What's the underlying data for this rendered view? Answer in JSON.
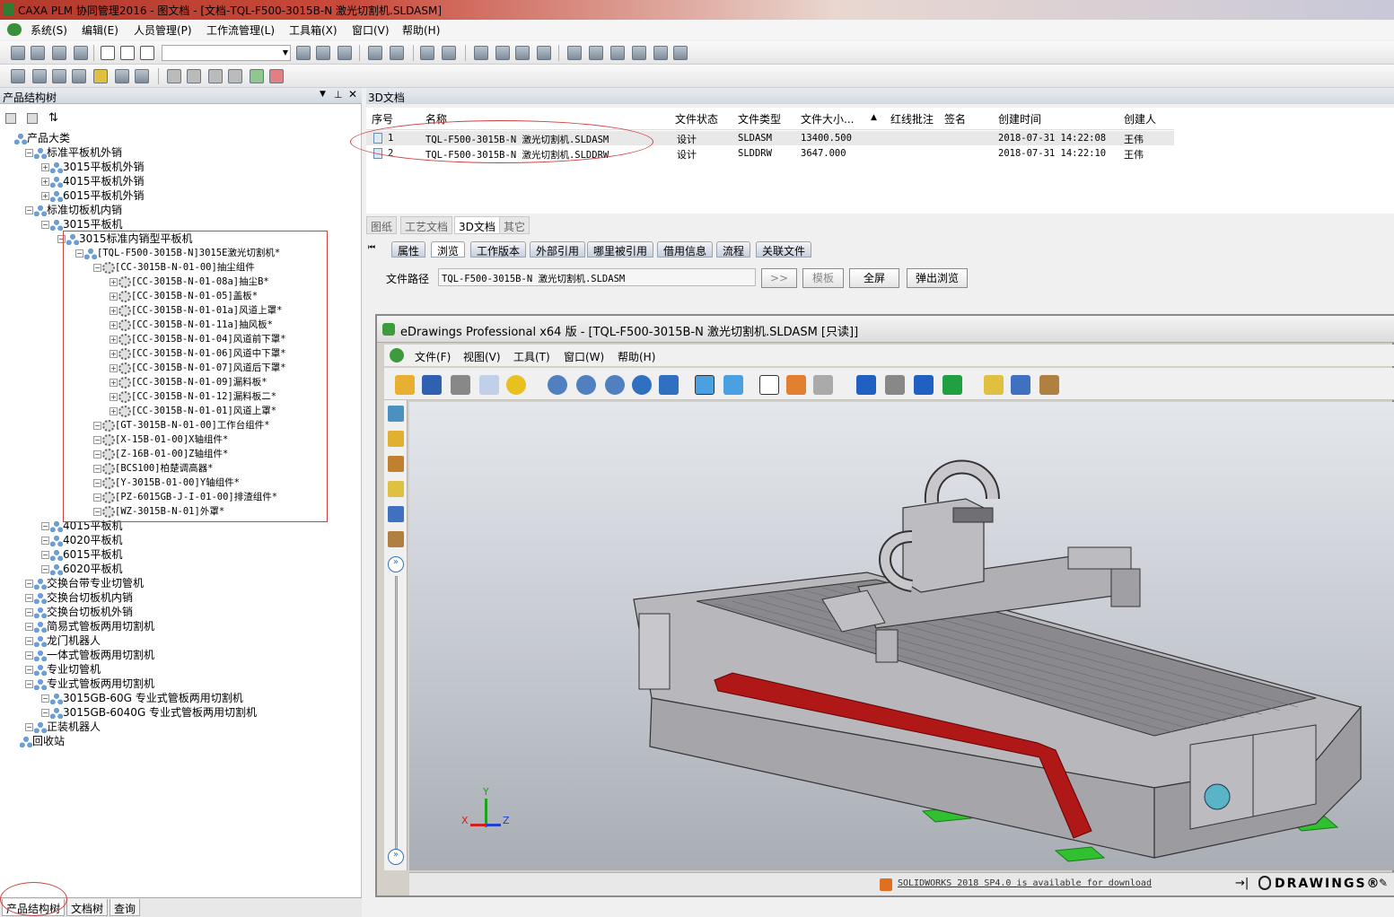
{
  "window": {
    "title": "CAXA PLM 协同管理2016 - 图文档 - [文档-TQL-F500-3015B-N 激光切割机.SLDASM]"
  },
  "menubar": [
    "系统(S)",
    "编辑(E)",
    "人员管理(P)",
    "工作流管理(L)",
    "工具箱(X)",
    "窗口(V)",
    "帮助(H)"
  ],
  "left_panel": {
    "title": "产品结构树",
    "root": "产品大类",
    "tree": [
      {
        "label": "标准平板机外销",
        "level": 1
      },
      {
        "label": "3015平板机外销",
        "level": 2
      },
      {
        "label": "4015平板机外销",
        "level": 2
      },
      {
        "label": "6015平板机外销",
        "level": 2
      },
      {
        "label": "标准切板机内销",
        "level": 1
      },
      {
        "label": "3015平板机",
        "level": 2
      },
      {
        "label": "3015标准内销型平板机",
        "level": 3
      },
      {
        "label": "[TQL-F500-3015B-N]3015E激光切割机*",
        "level": 4,
        "mono": true
      },
      {
        "label": "[CC-3015B-N-01-00]抽尘组件",
        "level": 5,
        "mono": true
      },
      {
        "label": "[CC-3015B-N-01-08a]抽尘B*",
        "level": 6,
        "mono": true
      },
      {
        "label": "[CC-3015B-N-01-05]盖板*",
        "level": 6,
        "mono": true
      },
      {
        "label": "[CC-3015B-N-01-01a]风道上罩*",
        "level": 6,
        "mono": true
      },
      {
        "label": "[CC-3015B-N-01-11a]抽风板*",
        "level": 6,
        "mono": true
      },
      {
        "label": "[CC-3015B-N-01-04]风道前下罩*",
        "level": 6,
        "mono": true
      },
      {
        "label": "[CC-3015B-N-01-06]风道中下罩*",
        "level": 6,
        "mono": true
      },
      {
        "label": "[CC-3015B-N-01-07]风道后下罩*",
        "level": 6,
        "mono": true
      },
      {
        "label": "[CC-3015B-N-01-09]漏料板*",
        "level": 6,
        "mono": true
      },
      {
        "label": "[CC-3015B-N-01-12]漏料板二*",
        "level": 6,
        "mono": true
      },
      {
        "label": "[CC-3015B-N-01-01]风道上罩*",
        "level": 6,
        "mono": true
      },
      {
        "label": "[GT-3015B-N-01-00]工作台组件*",
        "level": 5,
        "mono": true
      },
      {
        "label": "[X-15B-01-00]X轴组件*",
        "level": 5,
        "mono": true
      },
      {
        "label": "[Z-16B-01-00]Z轴组件*",
        "level": 5,
        "mono": true
      },
      {
        "label": "[BCS100]柏楚调高器*",
        "level": 5,
        "mono": true
      },
      {
        "label": "[Y-3015B-01-00]Y轴组件*",
        "level": 5,
        "mono": true
      },
      {
        "label": "[PZ-6015GB-J-I-01-00]排渣组件*",
        "level": 5,
        "mono": true
      },
      {
        "label": "[WZ-3015B-N-01]外罩*",
        "level": 5,
        "mono": true
      },
      {
        "label": "4015平板机",
        "level": 2
      },
      {
        "label": "4020平板机",
        "level": 2
      },
      {
        "label": "6015平板机",
        "level": 2
      },
      {
        "label": "6020平板机",
        "level": 2
      },
      {
        "label": "交换台带专业切管机",
        "level": 1
      },
      {
        "label": "交换台切板机内销",
        "level": 1
      },
      {
        "label": "交换台切板机外销",
        "level": 1
      },
      {
        "label": "简易式管板两用切割机",
        "level": 1
      },
      {
        "label": "龙门机器人",
        "level": 1
      },
      {
        "label": "一体式管板两用切割机",
        "level": 1
      },
      {
        "label": "专业切管机",
        "level": 1
      },
      {
        "label": "专业式管板两用切割机",
        "level": 1
      },
      {
        "label": "3015GB-60G 专业式管板两用切割机",
        "level": 2
      },
      {
        "label": "3015GB-6040G 专业式管板两用切割机",
        "level": 2
      },
      {
        "label": "正装机器人",
        "level": 1
      },
      {
        "label": "回收站",
        "level": 0
      }
    ],
    "bottom_tabs": [
      "产品结构树",
      "文档树",
      "查询"
    ]
  },
  "right_panel": {
    "title": "3D文档",
    "columns": [
      "序号",
      "名称",
      "文件状态",
      "文件类型",
      "文件大小...",
      "红线批注",
      "签名",
      "创建时间",
      "创建人"
    ],
    "rows": [
      {
        "no": "1",
        "name": "TQL-F500-3015B-N 激光切割机.SLDASM",
        "status": "设计",
        "type": "SLDASM",
        "size": "13400.500",
        "created": "2018-07-31 14:22:08",
        "creator": "王伟"
      },
      {
        "no": "2",
        "name": "TQL-F500-3015B-N 激光切割机.SLDDRW",
        "status": "设计",
        "type": "SLDDRW",
        "size": "3647.000",
        "created": "2018-07-31 14:22:10",
        "creator": "王伟"
      }
    ],
    "doc_tabs": [
      "图纸",
      "工艺文档",
      "3D文档",
      "其它"
    ],
    "detail_tabs": [
      "属性",
      "浏览",
      "工作版本",
      "外部引用",
      "哪里被引用",
      "借用信息",
      "流程",
      "关联文件"
    ],
    "path_label": "文件路径",
    "path_value": "TQL-F500-3015B-N 激光切割机.SLDASM",
    "buttons": {
      "more": ">>",
      "template": "模板",
      "fullscreen": "全屏",
      "popup": "弹出浏览"
    }
  },
  "edrawings": {
    "title": "eDrawings Professional x64 版 - [TQL-F500-3015B-N 激光切割机.SLDASM [只读]]",
    "menu": [
      "文件(F)",
      "视图(V)",
      "工具(T)",
      "窗口(W)",
      "帮助(H)"
    ],
    "status": "SOLIDWORKS 2018 SP4.0 is available for download",
    "brand": "DRAWINGS®",
    "axes": [
      "X",
      "Y",
      "Z"
    ]
  }
}
